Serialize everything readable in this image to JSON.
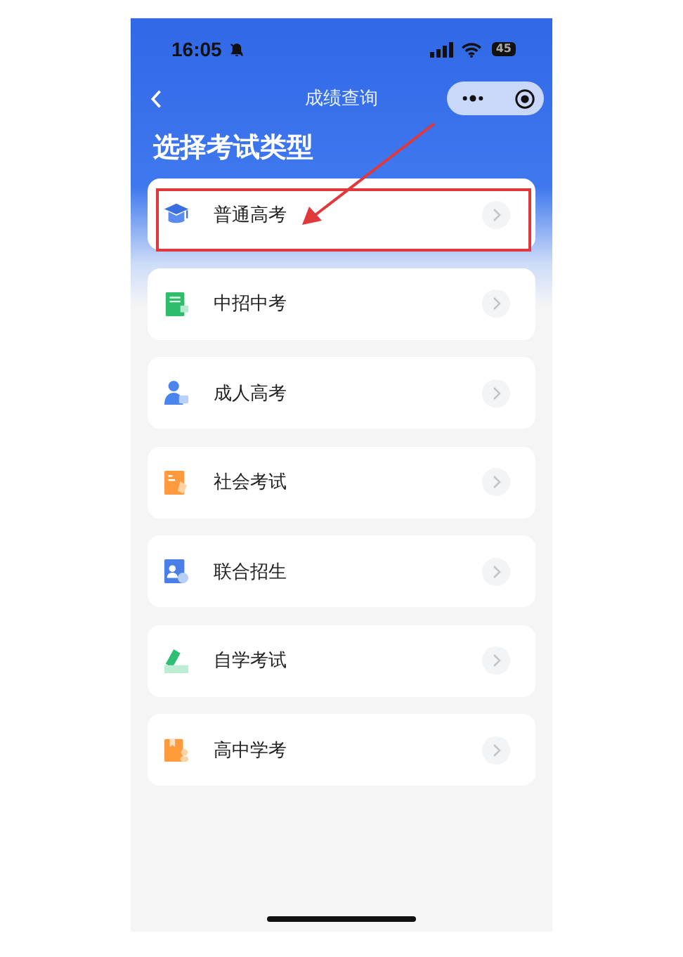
{
  "status_bar": {
    "time": "16:05",
    "battery": "45"
  },
  "nav": {
    "title": "成绩查询"
  },
  "heading": "选择考试类型",
  "items": [
    {
      "label": "普通高考",
      "annotated": true
    },
    {
      "label": "中招中考",
      "annotated": false
    },
    {
      "label": "成人高考",
      "annotated": false
    },
    {
      "label": "社会考试",
      "annotated": false
    },
    {
      "label": "联合招生",
      "annotated": false
    },
    {
      "label": "自学考试",
      "annotated": false
    },
    {
      "label": "高中学考",
      "annotated": false
    }
  ]
}
